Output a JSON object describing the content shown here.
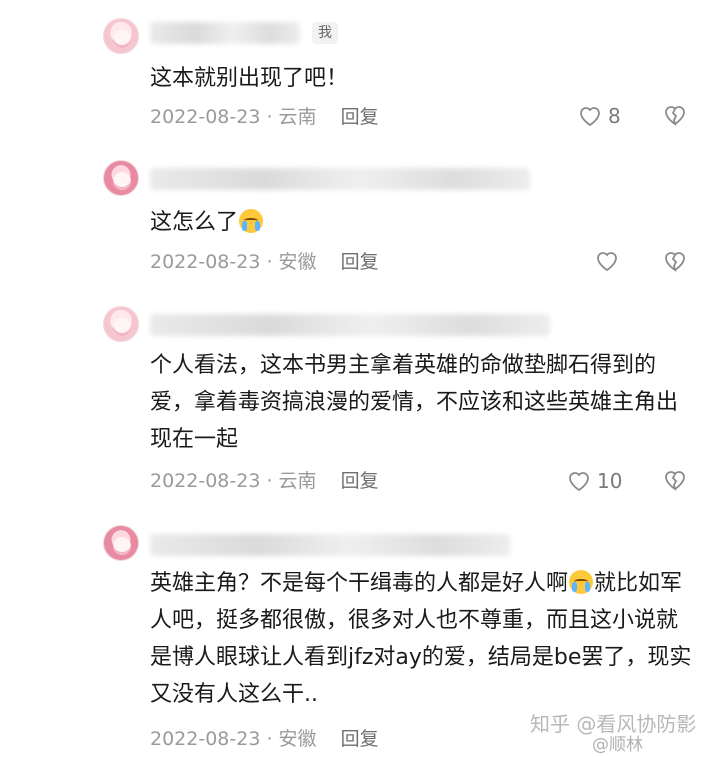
{
  "comments": [
    {
      "self_badge": "我",
      "text": "这本就别出现了吧！",
      "date": "2022-08-23",
      "location": "云南",
      "reply_label": "回复",
      "likes": "8"
    },
    {
      "text": "这怎么了",
      "date": "2022-08-23",
      "location": "安徽",
      "reply_label": "回复",
      "likes": ""
    },
    {
      "text": "个人看法，这本书男主拿着英雄的命做垫脚石得到的爱，拿着毒资搞浪漫的爱情，不应该和这些英雄主角出现在一起",
      "date": "2022-08-23",
      "location": "云南",
      "reply_label": "回复",
      "likes": "10"
    },
    {
      "text_a": "英雄主角？不是每个干缉毒的人都是好人啊",
      "text_b": "就比如军人吧，挺多都很傲，很多对人也不尊重，而且这小说就是博人眼球让人看到jfz对ay的爱，结局是be罢了，现实又没有人这么干..",
      "date": "2022-08-23",
      "location": "安徽",
      "reply_label": "回复"
    }
  ],
  "separator": " · ",
  "watermark": "知乎 @看风协防影",
  "watermark_weibo": "@顺林"
}
